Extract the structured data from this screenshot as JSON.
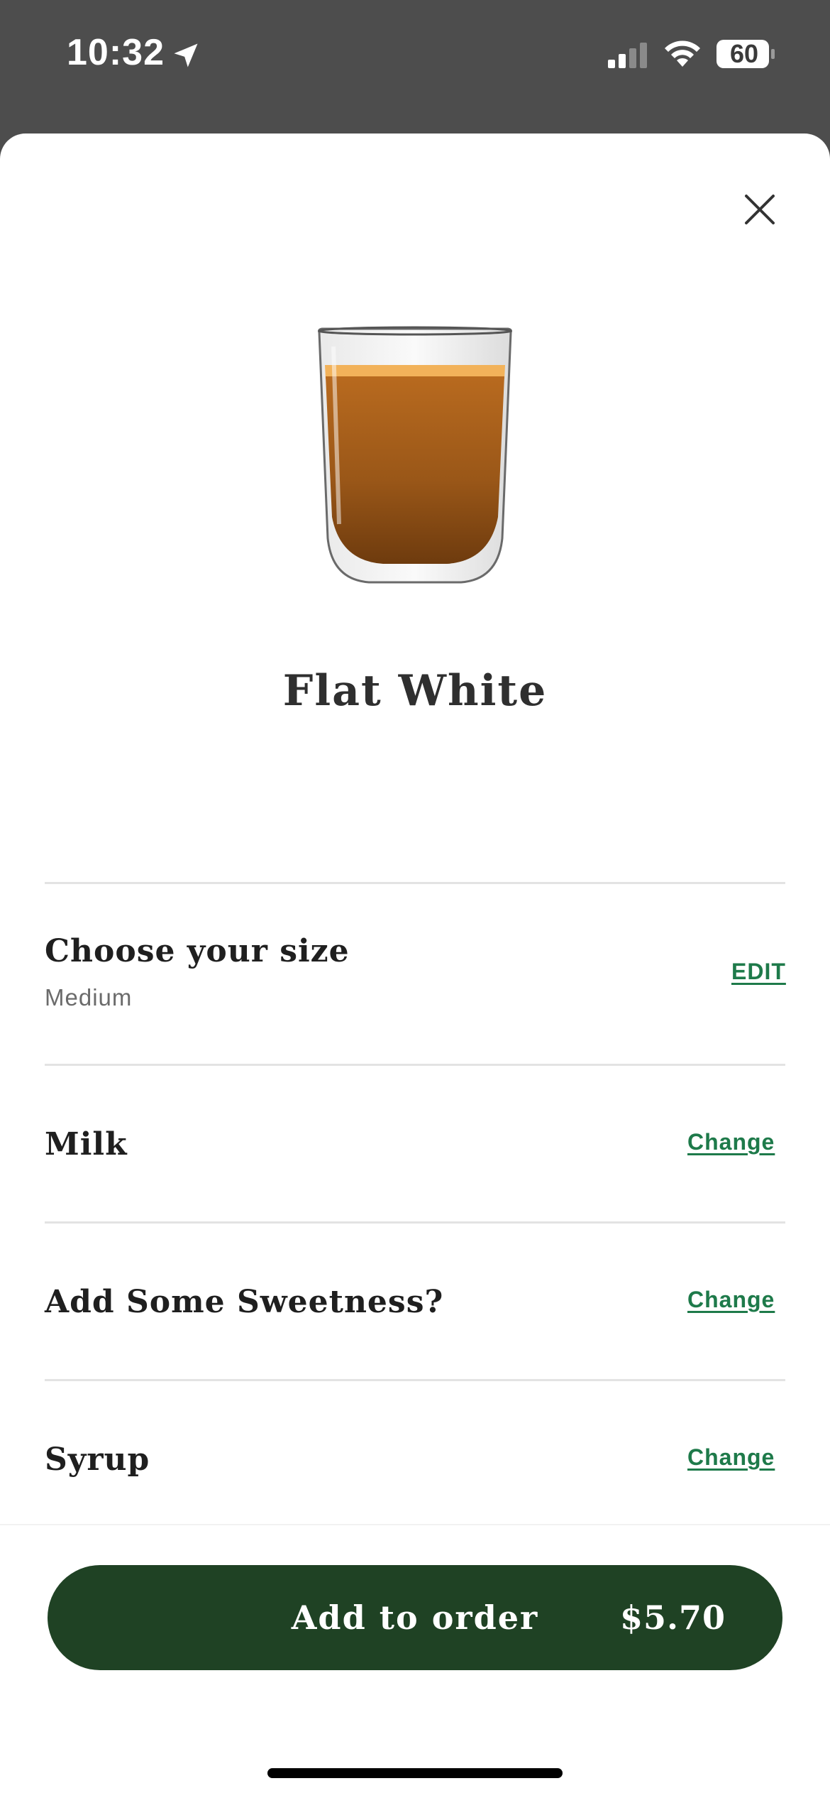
{
  "status_bar": {
    "time": "10:32",
    "battery": "60",
    "location_icon": "location-arrow-icon",
    "signal_icon": "cellular-signal-icon",
    "wifi_icon": "wifi-icon",
    "battery_icon": "battery-icon"
  },
  "product": {
    "name": "Flat White",
    "image": "flat-white-glass-image"
  },
  "options": [
    {
      "title": "Choose your size",
      "subtitle": "Medium",
      "action": "EDIT"
    },
    {
      "title": "Milk",
      "action": "Change"
    },
    {
      "title": "Add Some Sweetness?",
      "action": "Change"
    },
    {
      "title": "Syrup",
      "action": "Change"
    }
  ],
  "cta": {
    "label": "Add to order",
    "price": "$5.70"
  },
  "colors": {
    "accent_green": "#1e7a4a",
    "button_green": "#1f4224",
    "status_bar_bg": "#4d4d4d"
  }
}
